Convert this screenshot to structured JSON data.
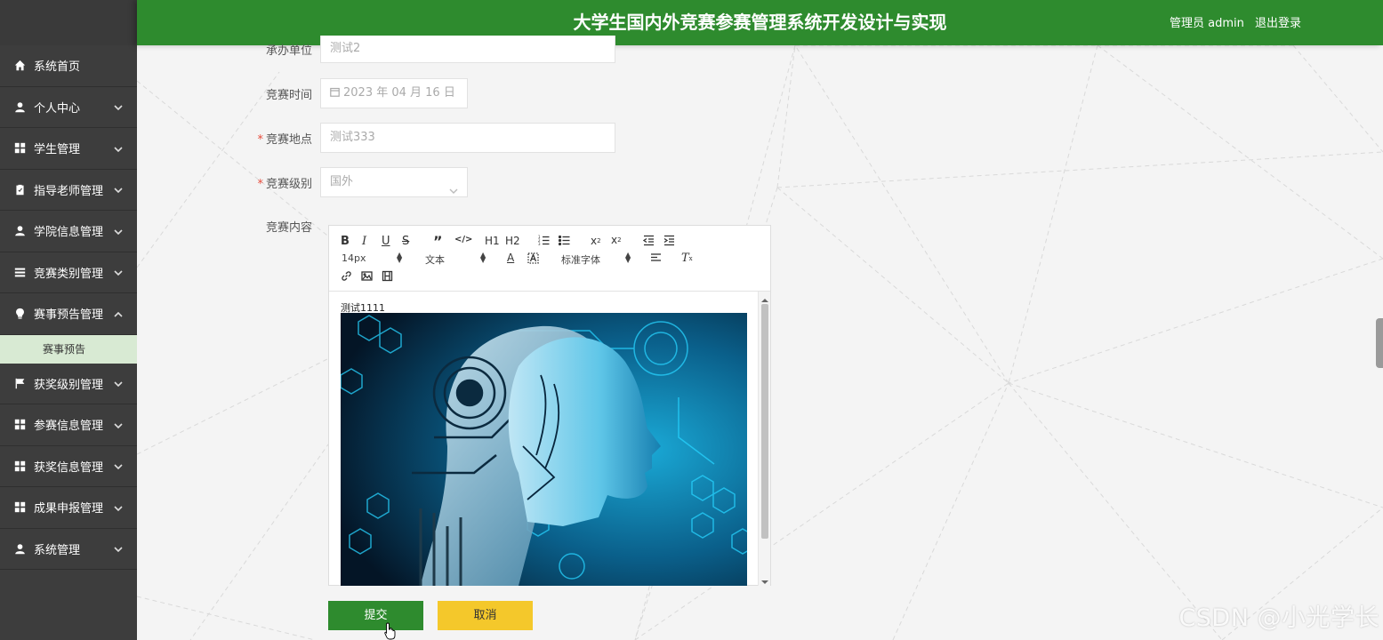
{
  "header": {
    "title": "大学生国内外竞赛参赛管理系统开发设计与实现",
    "user_label": "管理员 admin",
    "logout_label": "退出登录"
  },
  "sidebar": {
    "items": [
      {
        "label": "系统首页",
        "icon": "home-icon",
        "has_chevron": false
      },
      {
        "label": "个人中心",
        "icon": "user-icon",
        "has_chevron": true
      },
      {
        "label": "学生管理",
        "icon": "grid-icon",
        "has_chevron": true
      },
      {
        "label": "指导老师管理",
        "icon": "clipboard-icon",
        "has_chevron": true
      },
      {
        "label": "学院信息管理",
        "icon": "user-icon",
        "has_chevron": true
      },
      {
        "label": "竞赛类别管理",
        "icon": "list-icon",
        "has_chevron": true
      },
      {
        "label": "赛事预告管理",
        "icon": "bulb-icon",
        "has_chevron": true,
        "expanded": true
      },
      {
        "label": "获奖级别管理",
        "icon": "flag-icon",
        "has_chevron": true
      },
      {
        "label": "参赛信息管理",
        "icon": "grid-icon",
        "has_chevron": true
      },
      {
        "label": "获奖信息管理",
        "icon": "grid-icon",
        "has_chevron": true
      },
      {
        "label": "成果申报管理",
        "icon": "grid-icon",
        "has_chevron": true
      },
      {
        "label": "系统管理",
        "icon": "user-icon",
        "has_chevron": true
      }
    ],
    "submenu": {
      "label": "赛事预告"
    }
  },
  "form": {
    "organizer": {
      "label": "承办单位",
      "value": "测试2"
    },
    "time": {
      "label": "竞赛时间",
      "value": "2023 年 04 月 16 日"
    },
    "location": {
      "label": "竞赛地点",
      "value": "测试333",
      "required": true
    },
    "level": {
      "label": "竞赛级别",
      "value": "国外",
      "required": true
    },
    "content": {
      "label": "竞赛内容",
      "text": "测试1111"
    }
  },
  "editor_toolbar": {
    "font_size": "14px",
    "text_format": "文本",
    "font_family": "标准字体",
    "h1": "H1",
    "h2": "H2"
  },
  "buttons": {
    "submit": "提交",
    "cancel": "取消"
  },
  "watermark": "CSDN @小光学长",
  "colors": {
    "header_bg": "#2e8b2e",
    "sidebar_bg": "#3d3d3d",
    "submit_bg": "#2e8b2e",
    "cancel_bg": "#f4c82b",
    "submenu_bg": "#d8ead3"
  }
}
